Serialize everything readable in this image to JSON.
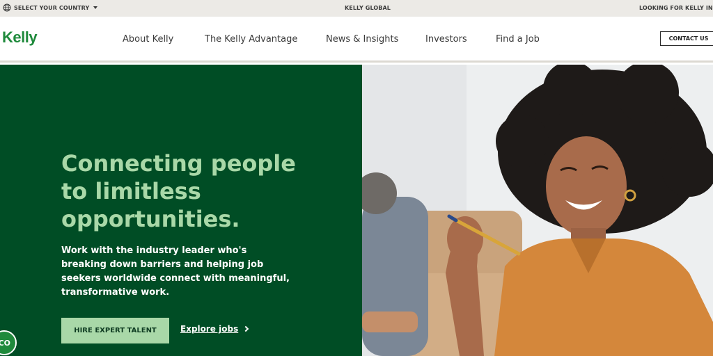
{
  "utility": {
    "country_label": "SELECT YOUR COUNTRY",
    "global_label": "KELLY GLOBAL",
    "looking_label": "LOOKING FOR KELLY IND"
  },
  "nav": {
    "logo": "Kelly",
    "items": [
      "About Kelly",
      "The Kelly Advantage",
      "News & Insights",
      "Investors",
      "Find a Job"
    ],
    "contact_label": "CONTACT US"
  },
  "hero": {
    "headline": "Connecting people to limitless opportunities.",
    "subtext": "Work with the industry leader who's breaking down barriers and helping job seekers worldwide connect with meaningful, transformative work.",
    "primary_cta": "HIRE EXPERT TALENT",
    "secondary_cta": "Explore jobs",
    "chat_badge": "CO"
  },
  "colors": {
    "brand_green": "#1f8a3c",
    "hero_green": "#004d25",
    "accent_mint": "#a9d8a8"
  }
}
